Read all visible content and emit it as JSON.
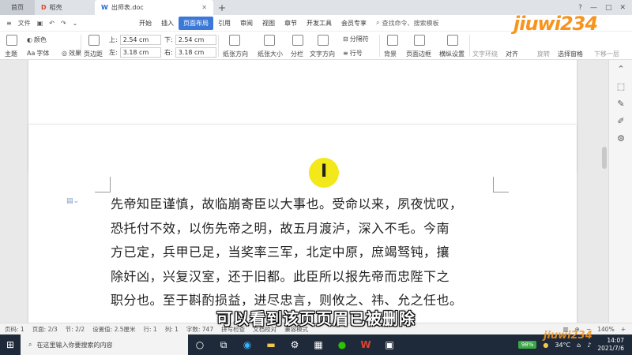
{
  "titlebar": {
    "tabs": [
      {
        "label": "首页"
      },
      {
        "label": "稻壳"
      },
      {
        "label": "出师表.doc"
      }
    ],
    "plus": "+"
  },
  "menubar": {
    "file_label": "文件",
    "items": [
      "开始",
      "插入",
      "页面布局",
      "引用",
      "审阅",
      "视图",
      "章节",
      "开发工具",
      "会员专享"
    ],
    "active_index": 2,
    "search_placeholder": "查找命令、搜索模板"
  },
  "ribbon": {
    "theme": "主题",
    "color": "颜色",
    "font": "字体",
    "effect": "效果",
    "margins": "页边距",
    "top_label": "上:",
    "top_value": "2.54 cm",
    "bottom_label": "下:",
    "bottom_value": "2.54 cm",
    "left_label": "左:",
    "left_value": "3.18 cm",
    "right_label": "右:",
    "right_value": "3.18 cm",
    "orientation": "纸张方向",
    "size": "纸张大小",
    "columns": "分栏",
    "text_direction": "文字方向",
    "line_numbers": "行号",
    "breaks": "分隔符",
    "background": "背景",
    "page_border": "页面边框",
    "layout_toggle": "横纵设置",
    "text_wrap": "文字环绕",
    "align": "对齐",
    "rotate": "旋转",
    "selection_pane": "选择窗格",
    "next_layer": "下移一层"
  },
  "document": {
    "lines": [
      "先帝知臣谨慎，故临崩寄臣以大事也。受命以来，夙夜忧叹，",
      "恐托付不效，以伤先帝之明，故五月渡泸，深入不毛。今南",
      "方已定，兵甲已足，当奖率三军，北定中原，庶竭驽钝，攘",
      "除奸凶，兴复汉室，还于旧都。此臣所以报先帝而忠陛下之",
      "职分也。至于斟酌损益，进尽忠言，则攸之、祎、允之任也。"
    ]
  },
  "statusbar": {
    "page_num": "页码: 1",
    "pages": "页面: 2/3",
    "section": "节: 2/2",
    "setting": "设置值: 2.5厘米",
    "row": "行: 1",
    "col": "列: 1",
    "words": "字数: 747",
    "spell": "拼写检查",
    "proof": "文档校对",
    "mode": "兼容模式",
    "zoom": "140%"
  },
  "subtitle": "可以看到该页页眉已被删除",
  "taskbar": {
    "search_placeholder": "在这里输入你要搜索的内容",
    "battery": "98%",
    "temperature": "34°C",
    "time": "14:07",
    "date": "2021/7/6"
  },
  "watermark": "jiuwi234"
}
